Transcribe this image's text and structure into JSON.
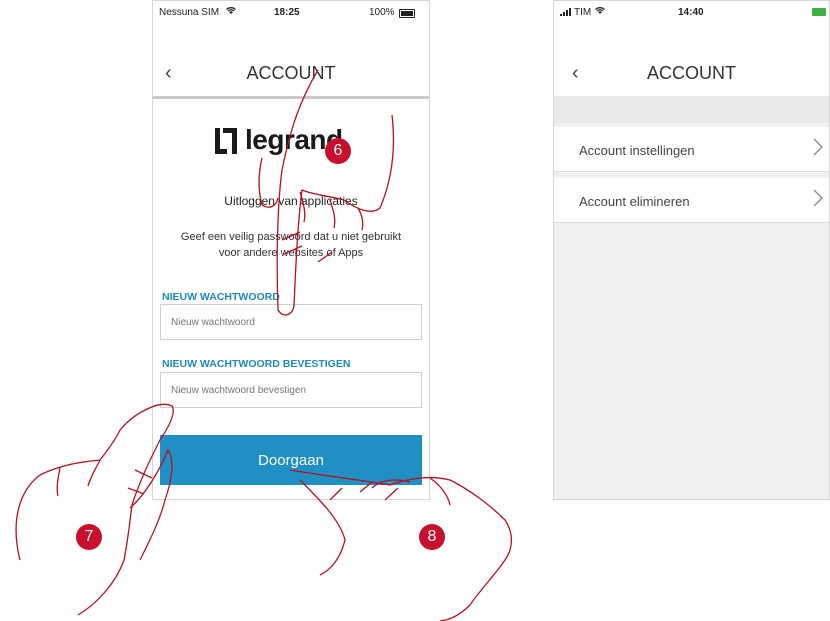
{
  "left_screen": {
    "status": {
      "carrier": "Nessuna SIM",
      "time": "18:25",
      "battery": "100%"
    },
    "nav": {
      "back_icon": "‹",
      "title": "ACCOUNT"
    },
    "logo": {
      "text": "legrand"
    },
    "heading": "Uitloggen van applicaties",
    "description_line1": "Geef een veilig passwoord dat u niet gebruikt",
    "description_line2": "voor andere websites of Apps",
    "new_password": {
      "label": "NIEUW WACHTWOORD",
      "placeholder": "Nieuw wachtwoord"
    },
    "confirm_password": {
      "label": "NIEUW WACHTWOORD BEVESTIGEN",
      "placeholder": "Nieuw wachtwoord bevestigen"
    },
    "continue_button": "Doorgaan"
  },
  "right_screen": {
    "status": {
      "carrier": "TIM",
      "time": "14:40"
    },
    "nav": {
      "back_icon": "‹",
      "title": "ACCOUNT"
    },
    "items": [
      {
        "label": "Account instellingen",
        "icon": "chevron-right-icon"
      },
      {
        "label": "Account elimineren",
        "icon": "chevron-right-icon"
      }
    ]
  },
  "callouts": [
    "6",
    "7",
    "8"
  ],
  "colors": {
    "accent": "#1f8fc4",
    "badge": "#c8102e",
    "label": "#1d8ac0"
  }
}
